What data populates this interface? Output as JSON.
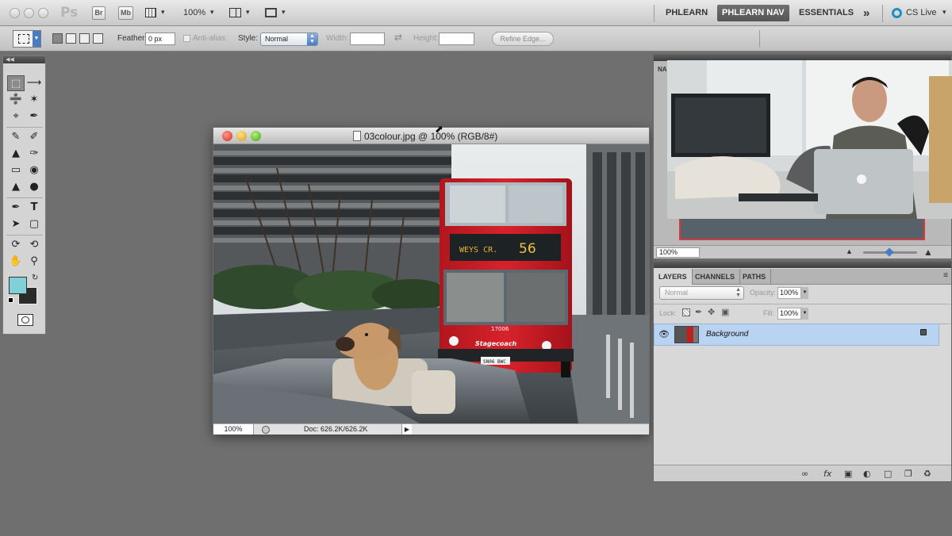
{
  "app": {
    "logo": "Ps",
    "bridge_label": "Br",
    "minibridge_label": "Mb",
    "zoom_label": "100%",
    "workspaces": [
      "PHLEARN",
      "PHLEARN NAV",
      "ESSENTIALS"
    ],
    "active_workspace": "PHLEARN NAV",
    "more_label": "»",
    "cs_live": "CS Live",
    "caret": "▾"
  },
  "options_bar": {
    "feather_label": "Feather:",
    "feather_value": "0 px",
    "antialias_label": "Anti-alias",
    "style_label": "Style:",
    "style_value": "Normal",
    "width_label": "Width:",
    "height_label": "Height:",
    "refine_edge_label": "Refine Edge..."
  },
  "document": {
    "title": "03colour.jpg @ 100% (RGB/8#)",
    "zoom": "100%",
    "doc_info": "Doc: 626.2K/626.2K",
    "image_caption": {
      "bus_number": "56",
      "bus_fleet": "17006",
      "bus_brand": "Stagecoach",
      "bus_plate": "SN06 BWC"
    }
  },
  "navigator": {
    "tab_label": "NA",
    "zoom": "100%"
  },
  "layers": {
    "tabs": [
      "LAYERS",
      "CHANNELS",
      "PATHS"
    ],
    "active_tab": "LAYERS",
    "blend_mode": "Normal",
    "opacity_label": "Opacity:",
    "opacity_value": "100%",
    "lock_label": "Lock:",
    "fill_label": "Fill:",
    "fill_value": "100%",
    "items": [
      {
        "name": "Background",
        "visible": true,
        "locked": true
      }
    ]
  },
  "colors": {
    "foreground": "#7fd0d8",
    "background": "#2b2b2b",
    "accent": "#4a7bc5",
    "selection": "#b9d3f3"
  }
}
